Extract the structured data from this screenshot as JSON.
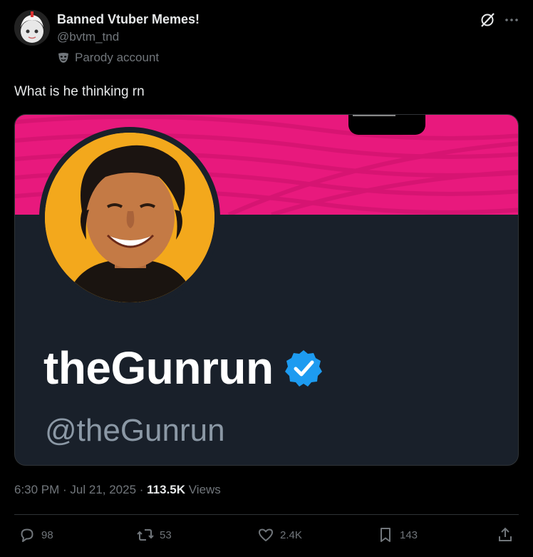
{
  "author": {
    "display_name": "Banned Vtuber Memes!",
    "handle": "@bvtm_tnd",
    "parody_label": "Parody account"
  },
  "tweet": {
    "text": "What is he thinking rn"
  },
  "media_card": {
    "name": "theGunrun",
    "handle": "@theGunrun",
    "banner_color": "#e8197d",
    "card_bg_color": "#19202a",
    "avatar_bg_color": "#f3a81c",
    "verified_color": "#1d9bf0"
  },
  "meta": {
    "timestamp": "6:30 PM · Jul 21, 2025 · ",
    "views_count": "113.5K",
    "views_label": " Views"
  },
  "actions": {
    "replies": "98",
    "reposts": "53",
    "likes": "2.4K",
    "bookmarks": "143"
  },
  "icons": [
    "grok-icon",
    "more-icon",
    "parody-mask-icon",
    "verified-icon",
    "reply-icon",
    "repost-icon",
    "like-icon",
    "bookmark-icon",
    "share-icon"
  ]
}
